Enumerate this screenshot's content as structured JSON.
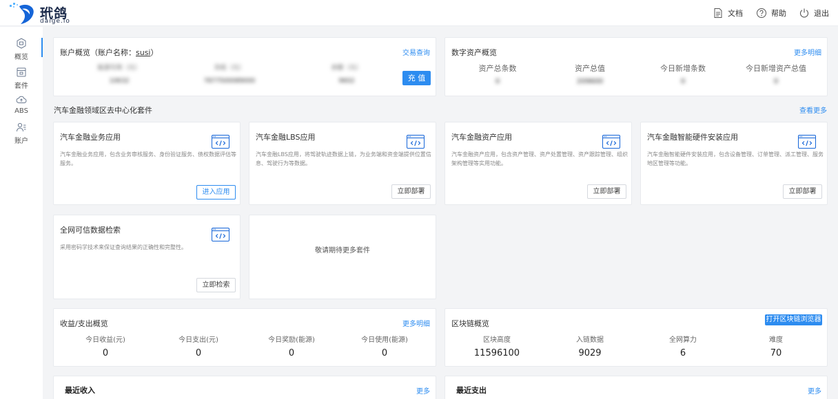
{
  "header": {
    "logo_cn": "玳鸽",
    "logo_en": "daige.io",
    "docs": "文档",
    "help": "帮助",
    "logout": "退出"
  },
  "sidebar": {
    "items": [
      {
        "label": "概览",
        "icon": "overview-icon",
        "active": true
      },
      {
        "label": "套件",
        "icon": "suite-icon"
      },
      {
        "label": "ABS",
        "icon": "cloud-icon"
      },
      {
        "label": "账户",
        "icon": "account-icon"
      }
    ]
  },
  "account": {
    "title_prefix": "账户概览（账户名称：",
    "username": "susi",
    "title_suffix": "）",
    "link": "交易查询",
    "recharge": "充 值",
    "blurred_labels": [
      "能源可用（元）",
      "冻结（元）",
      "余额（元）"
    ],
    "blurred_values": [
      "10632",
      "7877500089000",
      "9602"
    ]
  },
  "assets": {
    "title": "数字资产概览",
    "link": "更多明细",
    "columns": [
      {
        "label": "资产总条数",
        "value": "0"
      },
      {
        "label": "资产总值",
        "value": "209600"
      },
      {
        "label": "今日新增条数",
        "value": "0"
      },
      {
        "label": "今日新增资产总值",
        "value": "0"
      }
    ]
  },
  "suites": {
    "section_title": "汽车金融领域区去中心化套件",
    "section_link": "查看更多",
    "cards": [
      {
        "title": "汽车金融业务应用",
        "desc": "汽车金融业务应用，包含业务审核服务、身份验证服务、债权数据评估等服务。",
        "button": "进入应用"
      },
      {
        "title": "汽车金融LBS应用",
        "desc": "汽车金融LBS应用，将驾驶轨迹数据上链，为业务端和资金端提供位置信息、驾驶行为等数据。",
        "button": "立即部署"
      },
      {
        "title": "汽车金融资产应用",
        "desc": "汽车金融资产应用，包含资产管理、资产处置管理、资产跟踪管理、组织架构管理等实用功能。",
        "button": "立即部署"
      },
      {
        "title": "汽车金融智能硬件安装应用",
        "desc": "汽车金融智能硬件安装应用，包含设备管理、订单管理、派工管理、服务地区管理等功能。",
        "button": "立即部署"
      },
      {
        "title": "全网可信数据检索",
        "desc": "采用密码学技术来保证查询结果的正确性和完整性。",
        "button": "立即检索"
      }
    ],
    "coming_soon": "敬请期待更多套件"
  },
  "income": {
    "title": "收益/支出概览",
    "link": "更多明细",
    "columns": [
      {
        "label": "今日收益(元)",
        "value": "0"
      },
      {
        "label": "今日支出(元)",
        "value": "0"
      },
      {
        "label": "今日奖励(能源)",
        "value": "0"
      },
      {
        "label": "今日使用(能源)",
        "value": "0"
      }
    ]
  },
  "chain": {
    "title": "区块链概览",
    "button": "打开区块链浏览器",
    "columns": [
      {
        "label": "区块高度",
        "value": "11596100"
      },
      {
        "label": "入链数据",
        "value": "9029"
      },
      {
        "label": "全网算力",
        "value": "6"
      },
      {
        "label": "难度",
        "value": "70"
      }
    ]
  },
  "recent_income": {
    "title": "最近收入",
    "link": "更多"
  },
  "recent_expense": {
    "title": "最近支出",
    "link": "更多"
  },
  "colors": {
    "accent": "#2d8cf0",
    "background": "#f3f4f6"
  }
}
